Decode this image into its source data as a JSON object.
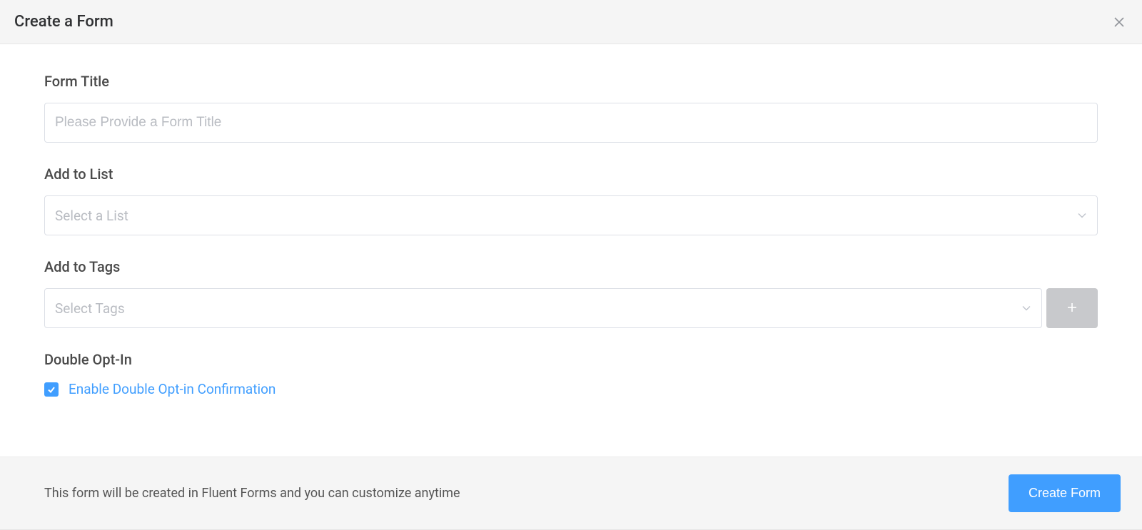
{
  "header": {
    "title": "Create a Form"
  },
  "fields": {
    "title": {
      "label": "Form Title",
      "placeholder": "Please Provide a Form Title",
      "value": ""
    },
    "list": {
      "label": "Add to List",
      "placeholder": "Select a List"
    },
    "tags": {
      "label": "Add to Tags",
      "placeholder": "Select Tags"
    },
    "double_optin": {
      "label": "Double Opt-In",
      "checkbox_label": "Enable Double Opt-in Confirmation",
      "checked": true
    }
  },
  "footer": {
    "note": "This form will be created in Fluent Forms and you can customize anytime",
    "create_label": "Create Form"
  }
}
